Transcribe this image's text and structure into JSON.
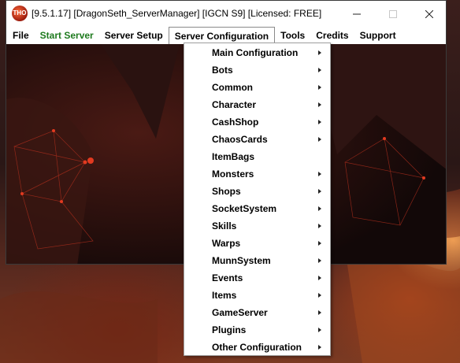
{
  "window": {
    "title": "[9.5.1.17] [DragonSeth_ServerManager] [IGCN S9] [Licensed: FREE]",
    "icon_text": "THO",
    "icon": "app-logo-icon",
    "controls": {
      "minimize": "minimize-icon",
      "maximize": "maximize-icon",
      "close": "close-icon"
    }
  },
  "menubar": {
    "items": [
      {
        "label": "File"
      },
      {
        "label": "Start Server",
        "color": "#1e7a1e"
      },
      {
        "label": "Server Setup"
      },
      {
        "label": "Server Configuration",
        "open": true
      },
      {
        "label": "Tools"
      },
      {
        "label": "Credits"
      },
      {
        "label": "Support"
      }
    ]
  },
  "dropdown": {
    "items": [
      {
        "label": "Main Configuration",
        "submenu": true
      },
      {
        "label": "Bots",
        "submenu": true
      },
      {
        "label": "Common",
        "submenu": true
      },
      {
        "label": "Character",
        "submenu": true
      },
      {
        "label": "CashShop",
        "submenu": true
      },
      {
        "label": "ChaosCards",
        "submenu": true
      },
      {
        "label": "ItemBags",
        "submenu": false
      },
      {
        "label": "Monsters",
        "submenu": true
      },
      {
        "label": "Shops",
        "submenu": true
      },
      {
        "label": "SocketSystem",
        "submenu": true
      },
      {
        "label": "Skills",
        "submenu": true
      },
      {
        "label": "Warps",
        "submenu": true
      },
      {
        "label": "MunnSystem",
        "submenu": true
      },
      {
        "label": "Events",
        "submenu": true
      },
      {
        "label": "Items",
        "submenu": true
      },
      {
        "label": "GameServer",
        "submenu": true
      },
      {
        "label": "Plugins",
        "submenu": true
      },
      {
        "label": "Other Configuration",
        "submenu": true
      }
    ]
  },
  "colors": {
    "accent_green": "#1e7a1e",
    "background_art": "#1a0d0d"
  }
}
